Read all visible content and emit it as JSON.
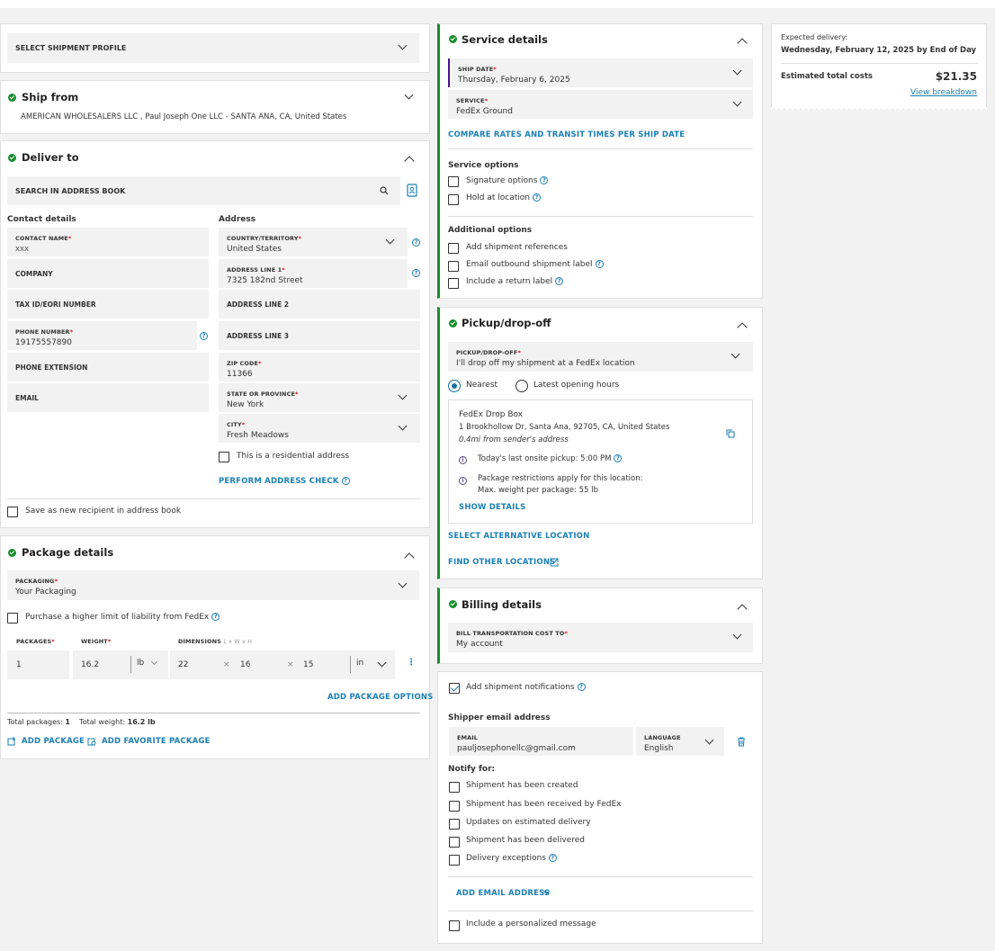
{
  "shipment_profile": {
    "label": "SELECT SHIPMENT PROFILE"
  },
  "ship_from": {
    "title": "Ship from",
    "address": "AMERICAN WHOLESALERS LLC , Paul Joseph One LLC - SANTA ANA, CA, United States"
  },
  "deliver_to": {
    "title": "Deliver to",
    "search_placeholder": "SEARCH IN ADDRESS BOOK",
    "contact_heading": "Contact details",
    "address_heading": "Address",
    "contact_name": {
      "label": "CONTACT NAME",
      "value": "xxx"
    },
    "company": {
      "label": "COMPANY"
    },
    "tax_id": {
      "label": "TAX ID/EORI NUMBER"
    },
    "phone": {
      "label": "PHONE NUMBER",
      "value": "19175557890"
    },
    "phone_ext": {
      "label": "PHONE EXTENSION"
    },
    "email": {
      "label": "EMAIL"
    },
    "country": {
      "label": "COUNTRY/TERRITORY",
      "value": "United States"
    },
    "address1": {
      "label": "ADDRESS LINE 1",
      "value": "7325 182nd Street"
    },
    "address2": {
      "label": "ADDRESS LINE 2"
    },
    "address3": {
      "label": "ADDRESS LINE 3"
    },
    "zip": {
      "label": "ZIP CODE",
      "value": "11366"
    },
    "state": {
      "label": "STATE OR PROVINCE",
      "value": "New York"
    },
    "city": {
      "label": "CITY",
      "value": "Fresh Meadows"
    },
    "residential_label": "This is a residential address",
    "address_check_link": "PERFORM ADDRESS CHECK",
    "save_recipient_label": "Save as new recipient in address book"
  },
  "package_details": {
    "title": "Package details",
    "packaging": {
      "label": "PACKAGING",
      "value": "Your Packaging"
    },
    "liability_label": "Purchase a higher limit of liability from FedEx",
    "col_packages": "PACKAGES",
    "col_weight": "WEIGHT",
    "col_dimensions": "DIMENSIONS",
    "dim_hint": "L x W x H",
    "packages_value": "1",
    "weight_value": "16.2",
    "weight_unit": "lb",
    "dim_l": "22",
    "dim_w": "16",
    "dim_h": "15",
    "dim_sep": "×",
    "dim_unit": "in",
    "add_options_link": "ADD PACKAGE OPTIONS",
    "total_packages_label": "Total packages:",
    "total_packages_value": "1",
    "total_weight_label": "Total weight:",
    "total_weight_value": "16.2 lb",
    "add_package_link": "ADD PACKAGE",
    "add_favorite_link": "ADD FAVORITE PACKAGE"
  },
  "service_details": {
    "title": "Service details",
    "ship_date": {
      "label": "SHIP DATE",
      "value": "Thursday, February 6, 2025"
    },
    "service": {
      "label": "SERVICE",
      "value": "FedEx Ground"
    },
    "compare_link": "COMPARE RATES AND TRANSIT TIMES PER SHIP DATE",
    "service_options_heading": "Service options",
    "signature_label": "Signature options",
    "hold_label": "Hold at location",
    "additional_heading": "Additional options",
    "references_label": "Add shipment references",
    "email_label_label": "Email outbound shipment label",
    "return_label_label": "Include a return label"
  },
  "pickup": {
    "title": "Pickup/drop-off",
    "select": {
      "label": "PICKUP/DROP-OFF",
      "value": "I'll drop off my shipment at a FedEx location"
    },
    "radio_nearest": "Nearest",
    "radio_latest": "Latest opening hours",
    "location_name": "FedEx Drop Box",
    "location_address": "1 Brookhollow Dr, Santa Ana, 92705, CA, United States",
    "location_distance": "0.4mi from sender's address",
    "last_pickup": "Today's last onsite pickup: 5:00 PM",
    "restriction_line1": "Package restrictions apply for this location:",
    "restriction_line2": "Max. weight per package: 55 lb",
    "show_details_link": "SHOW DETAILS",
    "select_alt_link": "SELECT ALTERNATIVE LOCATION",
    "find_other_link": "FIND OTHER LOCATIONS"
  },
  "billing": {
    "title": "Billing details",
    "bill_to": {
      "label": "BILL TRANSPORTATION COST TO",
      "value": "My account"
    }
  },
  "notifications": {
    "add_label": "Add shipment notifications",
    "shipper_email_heading": "Shipper email address",
    "email": {
      "label": "EMAIL",
      "value": "pauljosephonellc@gmail.com"
    },
    "language": {
      "label": "LANGUAGE",
      "value": "English"
    },
    "notify_heading": "Notify for:",
    "opt_created": "Shipment has been created",
    "opt_received": "Shipment has been received by FedEx",
    "opt_updates": "Updates on estimated delivery",
    "opt_delivered": "Shipment has been delivered",
    "opt_exceptions": "Delivery exceptions",
    "add_email_link": "ADD EMAIL ADDRESS",
    "personal_message_label": "Include a personalized message"
  },
  "summary": {
    "expected_label": "Expected delivery:",
    "expected_value": "Wednesday, February 12, 2025 by End of Day",
    "cost_label": "Estimated total costs",
    "cost_value": "$21.35",
    "breakdown_link": "View breakdown"
  },
  "colors": {
    "accent_green": "#1a8d2e",
    "link_blue": "#1a7fb5",
    "purple": "#5a4a8a"
  }
}
